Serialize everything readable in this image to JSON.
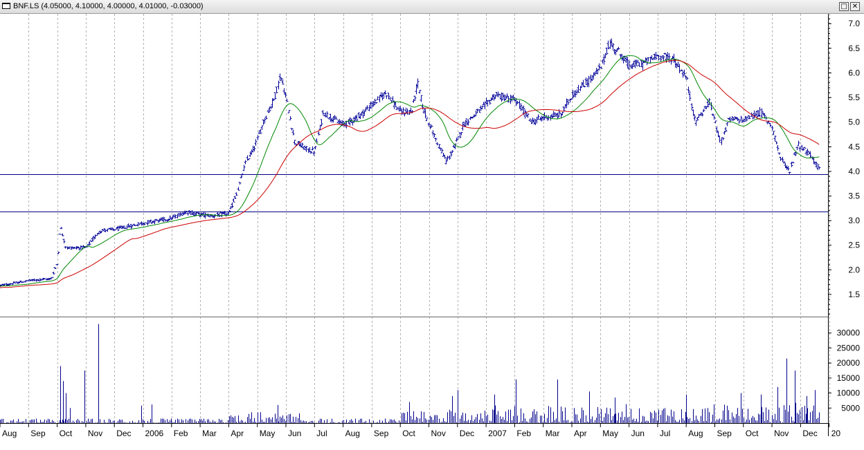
{
  "window": {
    "title": "BNF.LS (4.05000, 4.10000, 4.00000, 4.01000, -0.03000)",
    "restore_glyph": "□",
    "close_glyph": "✕"
  },
  "chart_data": [
    {
      "type": "line",
      "subtype": "ohlc",
      "title": "BNF.LS (4.05000, 4.10000, 4.00000, 4.01000, -0.03000)",
      "ylim": [
        1.05,
        7.2
      ],
      "yticks": [
        "7.0",
        "6.5",
        "6.0",
        "5.5",
        "5.0",
        "4.5",
        "4.0",
        "3.5",
        "3.0",
        "2.5",
        "2.0",
        "1.5"
      ],
      "ytick_values": [
        7.0,
        6.5,
        6.0,
        5.5,
        5.0,
        4.5,
        4.0,
        3.5,
        3.0,
        2.5,
        2.0,
        1.5
      ],
      "grid": "vertical dashed at month boundaries",
      "x_month_index_range": [
        0,
        28.7
      ],
      "price_path": [
        [
          0,
          1.68
        ],
        [
          1,
          1.78
        ],
        [
          1.8,
          1.82
        ],
        [
          2,
          2.15
        ],
        [
          2.1,
          2.9
        ],
        [
          2.3,
          2.45
        ],
        [
          3,
          2.45
        ],
        [
          3.5,
          2.8
        ],
        [
          4,
          2.82
        ],
        [
          5,
          2.95
        ],
        [
          6,
          3.05
        ],
        [
          6.5,
          3.18
        ],
        [
          7,
          3.12
        ],
        [
          7.5,
          3.1
        ],
        [
          8,
          3.15
        ],
        [
          8.3,
          3.6
        ],
        [
          8.6,
          4.2
        ],
        [
          8.9,
          4.5
        ],
        [
          9.2,
          5.0
        ],
        [
          9.6,
          5.5
        ],
        [
          9.8,
          5.95
        ],
        [
          10,
          5.5
        ],
        [
          10.3,
          4.6
        ],
        [
          10.7,
          4.45
        ],
        [
          11,
          4.4
        ],
        [
          11.3,
          5.2
        ],
        [
          11.7,
          5.05
        ],
        [
          12,
          4.95
        ],
        [
          12.5,
          5.1
        ],
        [
          13,
          5.35
        ],
        [
          13.5,
          5.6
        ],
        [
          14,
          5.2
        ],
        [
          14.4,
          5.22
        ],
        [
          14.6,
          5.8
        ],
        [
          14.8,
          5.25
        ],
        [
          15.2,
          4.7
        ],
        [
          15.6,
          4.2
        ],
        [
          15.9,
          4.5
        ],
        [
          16.2,
          4.95
        ],
        [
          16.8,
          5.25
        ],
        [
          17.3,
          5.55
        ],
        [
          18,
          5.45
        ],
        [
          18.6,
          5.0
        ],
        [
          19,
          5.1
        ],
        [
          19.6,
          5.15
        ],
        [
          20,
          5.55
        ],
        [
          20.6,
          5.85
        ],
        [
          21,
          6.1
        ],
        [
          21.3,
          6.6
        ],
        [
          21.6,
          6.45
        ],
        [
          22,
          6.15
        ],
        [
          22.5,
          6.2
        ],
        [
          23,
          6.35
        ],
        [
          23.5,
          6.3
        ],
        [
          24,
          5.9
        ],
        [
          24.3,
          5.0
        ],
        [
          24.8,
          5.4
        ],
        [
          25.2,
          4.6
        ],
        [
          25.5,
          5.05
        ],
        [
          26,
          5.05
        ],
        [
          26.6,
          5.2
        ],
        [
          27,
          4.9
        ],
        [
          27.3,
          4.25
        ],
        [
          27.6,
          4.0
        ],
        [
          27.9,
          4.55
        ],
        [
          28.3,
          4.35
        ],
        [
          28.7,
          4.01
        ]
      ],
      "series": [
        {
          "name": "",
          "color": "#000099",
          "kind": "ohlc-bars"
        },
        {
          "name": "",
          "color": "#008800",
          "kind": "moving-average",
          "window_bars": 20
        },
        {
          "name": "",
          "color": "#cc0000",
          "kind": "moving-average",
          "window_bars": 50
        }
      ],
      "horizontal_lines": [
        {
          "value": 3.94,
          "color": "#000080"
        },
        {
          "value": 3.19,
          "color": "#000080"
        }
      ]
    },
    {
      "type": "bar",
      "subtype": "volume",
      "ylim": [
        0,
        35000
      ],
      "yticks": [
        "30000",
        "25000",
        "20000",
        "15000",
        "10000",
        "5000"
      ],
      "ytick_values": [
        30000,
        25000,
        20000,
        15000,
        10000,
        5000
      ],
      "color": "#00008b",
      "spikes": [
        [
          2.1,
          19000
        ],
        [
          2.2,
          14000
        ],
        [
          2.3,
          10000
        ],
        [
          2.45,
          5000
        ],
        [
          2.95,
          17500
        ],
        [
          3.45,
          33000
        ],
        [
          4.95,
          5800
        ],
        [
          5.3,
          6200
        ],
        [
          9.7,
          6000
        ],
        [
          14.3,
          7000
        ],
        [
          15.8,
          9000
        ],
        [
          16.0,
          11000
        ],
        [
          17.3,
          9500
        ],
        [
          18.05,
          14500
        ],
        [
          19.5,
          14500
        ],
        [
          20.6,
          10500
        ],
        [
          21.5,
          8500
        ],
        [
          24,
          9500
        ],
        [
          25.9,
          10000
        ],
        [
          26.6,
          9500
        ],
        [
          27.2,
          12000
        ],
        [
          27.5,
          21500
        ],
        [
          27.8,
          17500
        ],
        [
          28.5,
          11000
        ],
        [
          28.2,
          9000
        ]
      ]
    }
  ],
  "x_axis": {
    "labels": [
      "Aug",
      "Sep",
      "Oct",
      "Nov",
      "Dec",
      "2006",
      "Feb",
      "Mar",
      "Apr",
      "May",
      "Jun",
      "Jul",
      "Aug",
      "Sep",
      "Oct",
      "Nov",
      "Dec",
      "2007",
      "Feb",
      "Mar",
      "Apr",
      "May",
      "Jun",
      "Jul",
      "Aug",
      "Sep",
      "Oct",
      "Nov",
      "Dec",
      "20"
    ]
  }
}
